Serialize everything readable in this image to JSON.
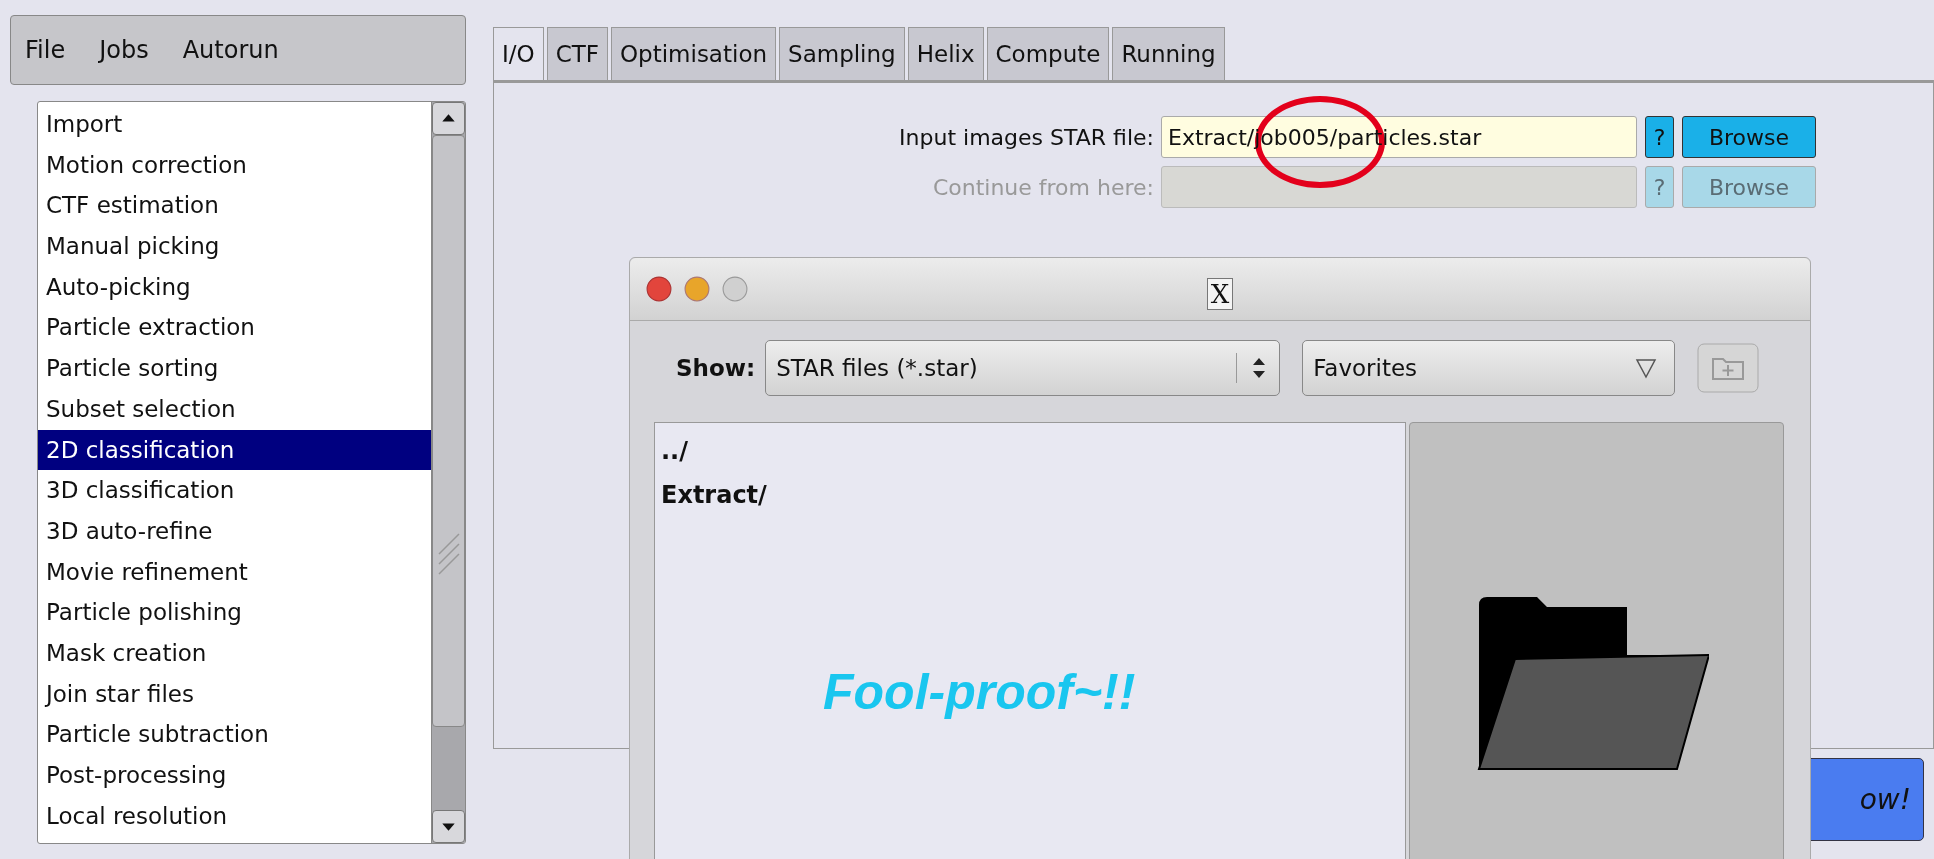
{
  "menu": [
    "File",
    "Jobs",
    "Autorun"
  ],
  "job_types": [
    {
      "label": "Import",
      "selected": false
    },
    {
      "label": "Motion correction",
      "selected": false
    },
    {
      "label": "CTF estimation",
      "selected": false
    },
    {
      "label": "Manual picking",
      "selected": false
    },
    {
      "label": "Auto-picking",
      "selected": false
    },
    {
      "label": "Particle extraction",
      "selected": false
    },
    {
      "label": "Particle sorting",
      "selected": false
    },
    {
      "label": "Subset selection",
      "selected": false
    },
    {
      "label": "2D classification",
      "selected": true
    },
    {
      "label": "3D classification",
      "selected": false
    },
    {
      "label": "3D auto-refine",
      "selected": false
    },
    {
      "label": "Movie refinement",
      "selected": false
    },
    {
      "label": "Particle polishing",
      "selected": false
    },
    {
      "label": "Mask creation",
      "selected": false
    },
    {
      "label": "Join star files",
      "selected": false
    },
    {
      "label": "Particle subtraction",
      "selected": false
    },
    {
      "label": "Post-processing",
      "selected": false
    },
    {
      "label": "Local resolution",
      "selected": false
    }
  ],
  "tabs": [
    {
      "label": "I/O",
      "selected": true
    },
    {
      "label": "CTF",
      "selected": false
    },
    {
      "label": "Optimisation",
      "selected": false
    },
    {
      "label": "Sampling",
      "selected": false
    },
    {
      "label": "Helix",
      "selected": false
    },
    {
      "label": "Compute",
      "selected": false
    },
    {
      "label": "Running",
      "selected": false
    }
  ],
  "fields": [
    {
      "label": "Input images STAR file:",
      "value": "Extract/job005/particles.star",
      "disabled": false,
      "help": "?",
      "button": "Browse"
    },
    {
      "label": "Continue from here:",
      "disabled": true,
      "help": "?",
      "button": "Browse"
    }
  ],
  "run_button": "ow!",
  "file_dialog": {
    "close_label": "X",
    "show_label": "Show:",
    "filter": "STAR files (*.star)",
    "location": "Favorites",
    "entries": [
      "../",
      "Extract/"
    ]
  },
  "annotation_text": "Fool-proof~!!"
}
